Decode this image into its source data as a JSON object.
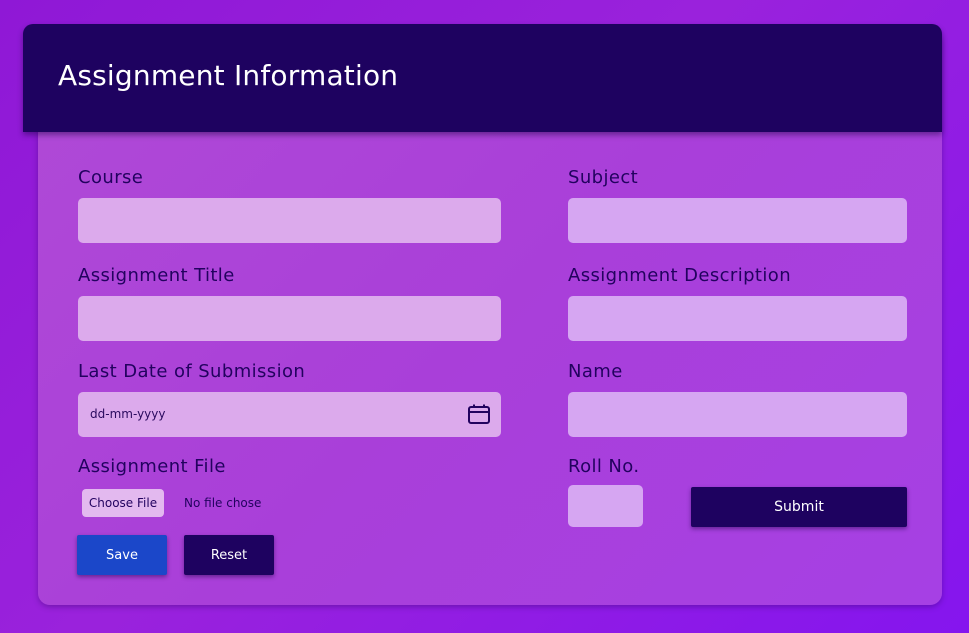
{
  "header": {
    "title": "Assignment Information"
  },
  "form": {
    "course": {
      "label": "Course",
      "value": ""
    },
    "subject": {
      "label": "Subject",
      "value": ""
    },
    "assignment_title": {
      "label": "Assignment Title",
      "value": ""
    },
    "assignment_description": {
      "label": "Assignment Description",
      "value": ""
    },
    "last_date": {
      "label": "Last Date of Submission",
      "placeholder": "dd-mm-yyyy"
    },
    "name": {
      "label": "Name",
      "value": ""
    },
    "assignment_file": {
      "label": "Assignment File",
      "button_label": "Choose File",
      "status_text": "No file chose"
    },
    "roll_no": {
      "label": "Roll No.",
      "value": ""
    }
  },
  "buttons": {
    "save": "Save",
    "reset": "Reset",
    "submit": "Submit"
  },
  "icons": {
    "calendar": "calendar-icon"
  },
  "colors": {
    "header_bg": "#1e0260",
    "label_text": "#22025f",
    "save_button": "#1b47c9",
    "dark_button": "#1e0260"
  }
}
